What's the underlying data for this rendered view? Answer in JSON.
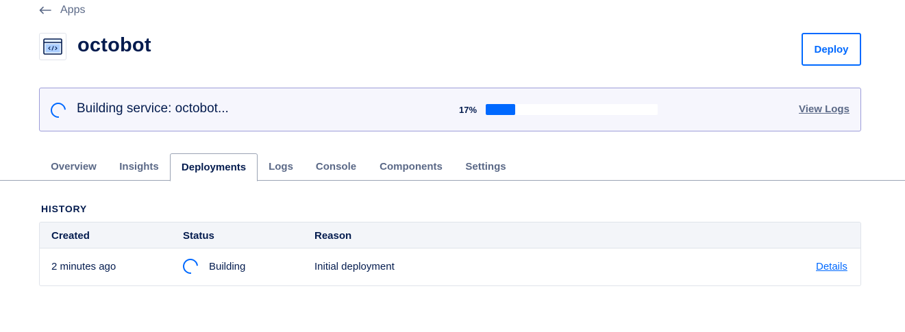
{
  "breadcrumb": {
    "back_label": "Apps"
  },
  "app": {
    "name": "octobot",
    "icon": "code-window-icon"
  },
  "header": {
    "deploy_label": "Deploy"
  },
  "build_banner": {
    "status_text": "Building service: octobot...",
    "percent_label": "17%",
    "progress": 0.17,
    "view_logs_label": "View Logs"
  },
  "tabs": [
    {
      "label": "Overview",
      "active": false
    },
    {
      "label": "Insights",
      "active": false
    },
    {
      "label": "Deployments",
      "active": true
    },
    {
      "label": "Logs",
      "active": false
    },
    {
      "label": "Console",
      "active": false
    },
    {
      "label": "Components",
      "active": false
    },
    {
      "label": "Settings",
      "active": false
    }
  ],
  "history": {
    "title": "HISTORY",
    "columns": [
      "Created",
      "Status",
      "Reason"
    ],
    "rows": [
      {
        "created": "2 minutes ago",
        "status": "Building",
        "reason": "Initial deployment",
        "action": "Details"
      }
    ]
  },
  "colors": {
    "accent": "#0069ff",
    "banner_bg": "#f6f6fd",
    "banner_border": "#9c9cd9",
    "text_primary": "#031b4e",
    "text_muted": "#5b6987"
  }
}
